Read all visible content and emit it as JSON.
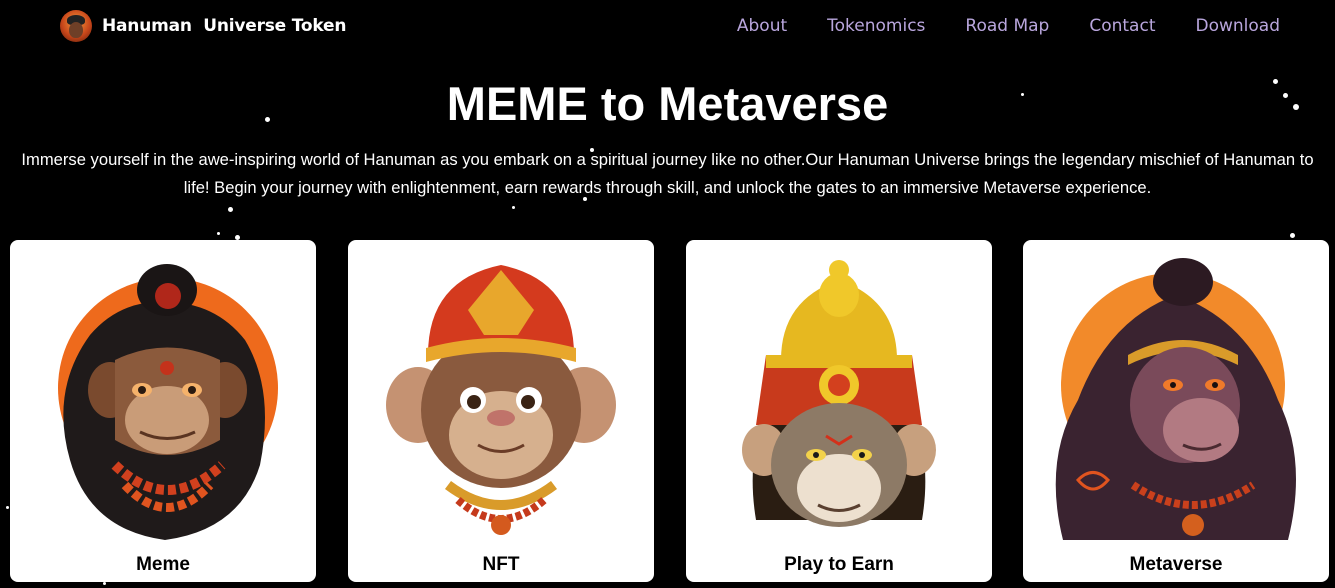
{
  "nav": {
    "brand": "Hanuman  Universe Token",
    "links": [
      {
        "label": "About"
      },
      {
        "label": "Tokenomics"
      },
      {
        "label": "Road Map"
      },
      {
        "label": "Contact"
      },
      {
        "label": "Download"
      }
    ]
  },
  "hero": {
    "title": "MEME to Metaverse",
    "description": "Immerse yourself in the awe-inspiring world of Hanuman as you embark on a spiritual journey like no other.Our Hanuman Universe brings the legendary mischief of Hanuman to life! Begin your journey with enlightenment, earn rewards through skill, and unlock the gates to an immersive Metaverse experience."
  },
  "cards": [
    {
      "label": "Meme"
    },
    {
      "label": "NFT"
    },
    {
      "label": "Play to Earn"
    },
    {
      "label": "Metaverse"
    }
  ],
  "colors": {
    "background": "#000000",
    "nav_link": "#b9a6dd",
    "card_bg": "#ffffff",
    "accent_orange": "#f27a1e"
  }
}
